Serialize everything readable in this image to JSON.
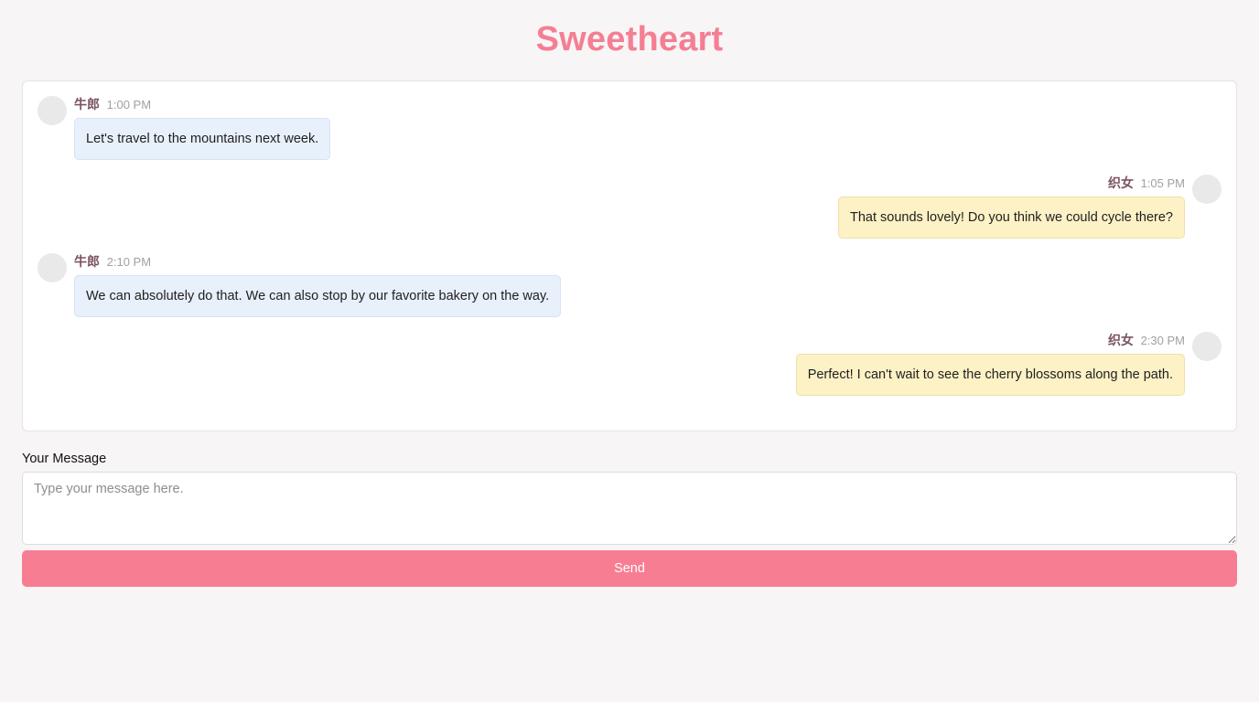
{
  "app": {
    "title": "Sweetheart"
  },
  "messages": [
    {
      "author": "牛郎",
      "time": "1:00 PM",
      "text": "Let's travel to the mountains next week.",
      "side": "left"
    },
    {
      "author": "织女",
      "time": "1:05 PM",
      "text": "That sounds lovely! Do you think we could cycle there?",
      "side": "right"
    },
    {
      "author": "牛郎",
      "time": "2:10 PM",
      "text": "We can absolutely do that. We can also stop by our favorite bakery on the way.",
      "side": "left"
    },
    {
      "author": "织女",
      "time": "2:30 PM",
      "text": "Perfect! I can't wait to see the cherry blossoms along the path.",
      "side": "right"
    }
  ],
  "composer": {
    "label": "Your Message",
    "placeholder": "Type your message here.",
    "value": "",
    "send_label": "Send"
  },
  "colors": {
    "accent": "#f77e92",
    "title": "#f47f93",
    "left_bubble": "#e8f0fc",
    "right_bubble": "#fdf1c6",
    "background": "#f8f5f6"
  }
}
